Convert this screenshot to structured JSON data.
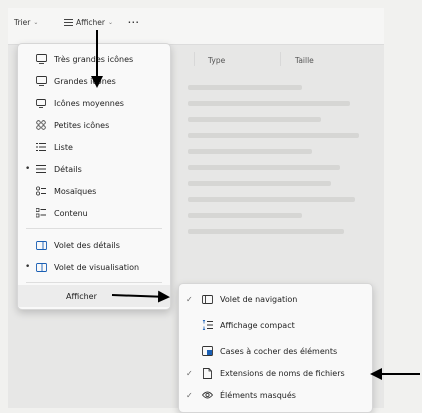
{
  "toolbar": {
    "sort_label": "Trier",
    "view_label": "Afficher",
    "more_label": "···"
  },
  "columns": {
    "type": "Type",
    "size": "Taille"
  },
  "view_menu": {
    "items": [
      {
        "label": "Très grandes icônes",
        "icon": "monitor-icon",
        "selected": false
      },
      {
        "label": "Grandes icônes",
        "icon": "monitor-icon",
        "selected": false
      },
      {
        "label": "Icônes moyennes",
        "icon": "monitor-icon",
        "selected": false
      },
      {
        "label": "Petites icônes",
        "icon": "small-icons-icon",
        "selected": false
      },
      {
        "label": "Liste",
        "icon": "list-icon",
        "selected": false
      },
      {
        "label": "Détails",
        "icon": "details-icon",
        "selected": true
      },
      {
        "label": "Mosaïques",
        "icon": "tiles-icon",
        "selected": false
      },
      {
        "label": "Contenu",
        "icon": "content-icon",
        "selected": false
      },
      {
        "label": "Volet des détails",
        "icon": "details-pane-icon",
        "selected": false
      },
      {
        "label": "Volet de visualisation",
        "icon": "preview-pane-icon",
        "selected": true
      }
    ],
    "show_label": "Afficher"
  },
  "show_submenu": {
    "items": [
      {
        "label": "Volet de navigation",
        "icon": "navigation-pane-icon",
        "checked": true
      },
      {
        "label": "Affichage compact",
        "icon": "compact-view-icon",
        "checked": false
      },
      {
        "label": "Cases à cocher des éléments",
        "icon": "checkbox-icon",
        "checked": false
      },
      {
        "label": "Extensions de noms de fichiers",
        "icon": "file-extension-icon",
        "checked": true
      },
      {
        "label": "Éléments masqués",
        "icon": "eye-icon",
        "checked": true
      }
    ]
  }
}
